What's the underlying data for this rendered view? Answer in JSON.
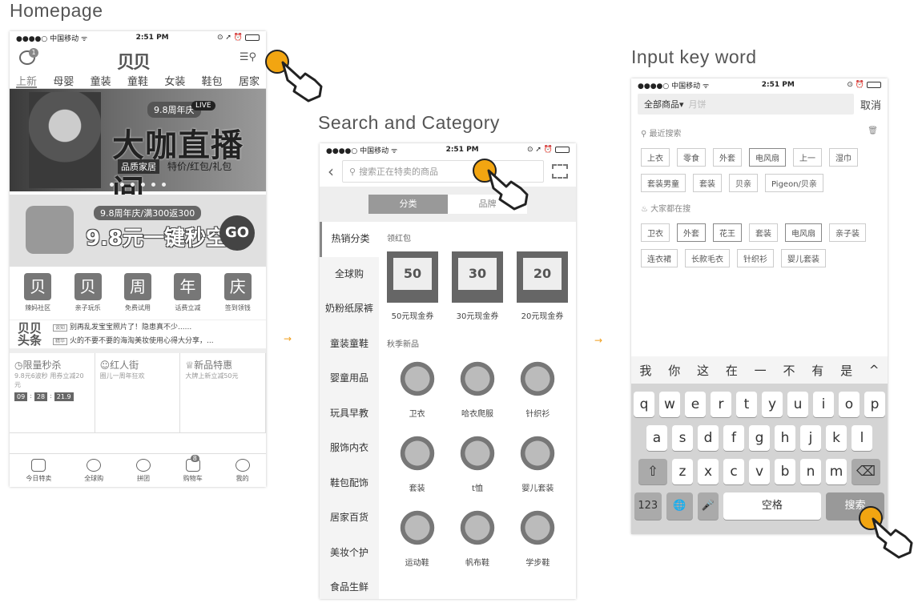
{
  "sections": {
    "homepage": "Homepage",
    "search_category": "Search and Category",
    "input_keyword": "Input key word"
  },
  "status": {
    "carrier": "●●●●○ 中国移动 ᯤ",
    "time": "2:51 PM",
    "icons": "⊙ ➚ ⏰"
  },
  "p1": {
    "logo": "贝贝",
    "msg_badge": "1",
    "tabs": [
      "上新",
      "母婴",
      "童装",
      "童鞋",
      "女装",
      "鞋包",
      "居家"
    ],
    "banner_tag": "9.8周年庆",
    "banner_live": "LIVE",
    "banner_big": "大咖直播间",
    "banner_sub1": "品质家居",
    "banner_sub2": "特价/红包/礼包",
    "promo_tag": "9.8周年庆/满300返300",
    "promo_big": "9.8元一键秒空!",
    "promo_go": "GO",
    "icons": [
      {
        "g": "贝",
        "l": "辣妈社区"
      },
      {
        "g": "贝",
        "l": "亲子玩乐"
      },
      {
        "g": "周",
        "l": "免费试用"
      },
      {
        "g": "年",
        "l": "话费立减"
      },
      {
        "g": "庆",
        "l": "签到领钱"
      }
    ],
    "news_logo": "贝贝头条",
    "news": [
      {
        "tag": "谈知",
        "text": "别再乱发宝宝照片了！隐患真不少......"
      },
      {
        "tag": "精华",
        "text": "火的不要不要的海淘美妆使用心得大分享，..."
      }
    ],
    "flash": [
      {
        "title": "◷限量秒杀",
        "sub": "9.8元6波秒 用券立减20元"
      },
      {
        "title": "☺红人街",
        "sub": "圈儿一周年狂欢"
      },
      {
        "title": "♕新品特惠",
        "sub": "大牌上新立减50元"
      }
    ],
    "timer": [
      "09",
      "28",
      "21.9"
    ],
    "tabbar": [
      {
        "l": "今日特卖"
      },
      {
        "l": "全球购"
      },
      {
        "l": "拼团"
      },
      {
        "l": "购物车",
        "b": "8"
      },
      {
        "l": "我的"
      }
    ]
  },
  "p2": {
    "search_placeholder": "搜索正在特卖的商品",
    "seg": [
      "分类",
      "品牌"
    ],
    "side": [
      "热销分类",
      "全球购",
      "奶粉纸尿裤",
      "童装童鞋",
      "婴童用品",
      "玩具早教",
      "服饰内衣",
      "鞋包配饰",
      "居家百货",
      "美妆个护",
      "食品生鲜"
    ],
    "coupon_head": "领红包",
    "coupons": [
      {
        "v": "50",
        "l": "50元现金券"
      },
      {
        "v": "30",
        "l": "30元现金券"
      },
      {
        "v": "20",
        "l": "20元现金券"
      }
    ],
    "goods_head": "秋季新品",
    "goods": [
      "卫衣",
      "哈衣爬服",
      "针织衫",
      "套装",
      "t恤",
      "婴儿套装",
      "运动鞋",
      "帆布鞋",
      "学步鞋"
    ]
  },
  "p3": {
    "scope": "全部商品▾",
    "input": "月饼",
    "cancel": "取消",
    "recent_title": "最近搜索",
    "recent": [
      "上衣",
      "零食",
      "外套",
      "电风扇",
      "上一",
      "湿巾",
      "套装男童",
      "套装",
      "贝亲",
      "Pigeon/贝亲"
    ],
    "hot_title": "大家都在搜",
    "hot": [
      "卫衣",
      "外套",
      "花王",
      "套装",
      "电风扇",
      "亲子装",
      "连衣裙",
      "长款毛衣",
      "针织衫",
      "婴儿套装"
    ],
    "candidates": [
      "我",
      "你",
      "这",
      "在",
      "一",
      "不",
      "有",
      "是",
      "^"
    ],
    "row1": [
      "q",
      "w",
      "e",
      "r",
      "t",
      "y",
      "u",
      "i",
      "o",
      "p"
    ],
    "row2": [
      "a",
      "s",
      "d",
      "f",
      "g",
      "h",
      "j",
      "k",
      "l"
    ],
    "row3": [
      "z",
      "x",
      "c",
      "v",
      "b",
      "n",
      "m"
    ],
    "num": "123",
    "space": "空格",
    "search": "搜索"
  },
  "arrows": "→"
}
